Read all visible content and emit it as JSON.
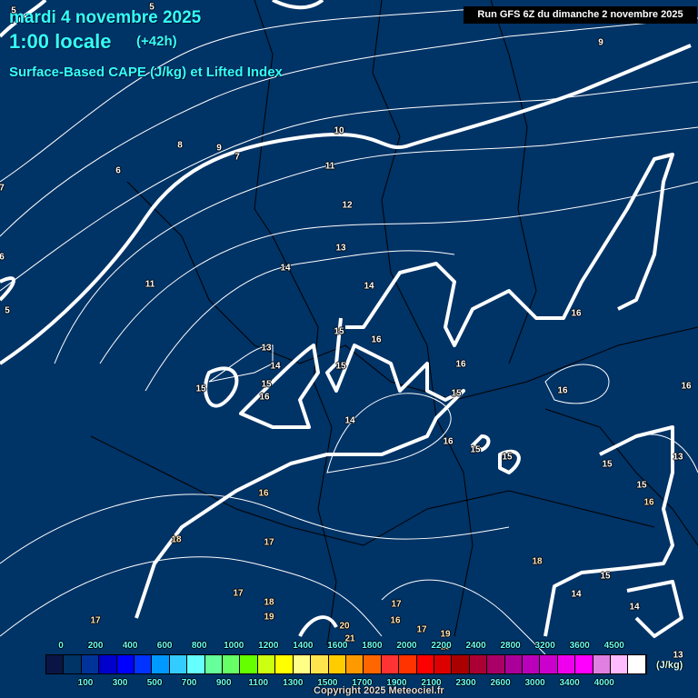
{
  "header": {
    "date": "mardi 4 novembre 2025",
    "time": "1:00 locale",
    "lead": "(+42h)",
    "title": "Surface-Based CAPE (J/kg) et Lifted Index",
    "run": "Run GFS 6Z du dimanche 2 novembre 2025"
  },
  "colorbar": {
    "colors": [
      "#0a1545",
      "#003366",
      "#003399",
      "#0000cc",
      "#0000ff",
      "#0033ff",
      "#0099ff",
      "#33ccff",
      "#66ffff",
      "#66ff99",
      "#66ff66",
      "#66ff00",
      "#ccff11",
      "#ffff00",
      "#ffff88",
      "#ffe44d",
      "#ffcc00",
      "#ff9900",
      "#ff6600",
      "#ff3333",
      "#ff3300",
      "#ff0000",
      "#dd0000",
      "#aa0000",
      "#aa0033",
      "#aa0066",
      "#aa0099",
      "#bb00bb",
      "#cc00cc",
      "#ee00ee",
      "#ff00ff",
      "#e080e0",
      "#ffbbff",
      "#ffffff"
    ],
    "top_labels": [
      "0",
      "200",
      "400",
      "600",
      "800",
      "1000",
      "1200",
      "1400",
      "1600",
      "1800",
      "2000",
      "2200",
      "2400",
      "2800",
      "3200",
      "3600",
      "4500"
    ],
    "bottom_labels": [
      "100",
      "300",
      "500",
      "700",
      "900",
      "1100",
      "1300",
      "1500",
      "1700",
      "1900",
      "2100",
      "2300",
      "2600",
      "3000",
      "3400",
      "4000"
    ],
    "unit": "(J/kg)"
  },
  "lifted_index_labels": [
    "5",
    "5",
    "6",
    "7",
    "8",
    "9",
    "7",
    "6",
    "5",
    "10",
    "9",
    "11",
    "12",
    "13",
    "14",
    "14",
    "11",
    "15",
    "16",
    "13",
    "14",
    "15",
    "16",
    "15",
    "16",
    "15",
    "16",
    "16",
    "16",
    "15",
    "15",
    "15",
    "13",
    "15",
    "15",
    "14",
    "16",
    "17",
    "18",
    "16",
    "17",
    "18",
    "17",
    "17",
    "19",
    "20",
    "21",
    "16",
    "17",
    "19",
    "18",
    "18",
    "14",
    "14",
    "15",
    "16",
    "13"
  ],
  "copyright": "Copyright 2025 Meteociel.fr"
}
